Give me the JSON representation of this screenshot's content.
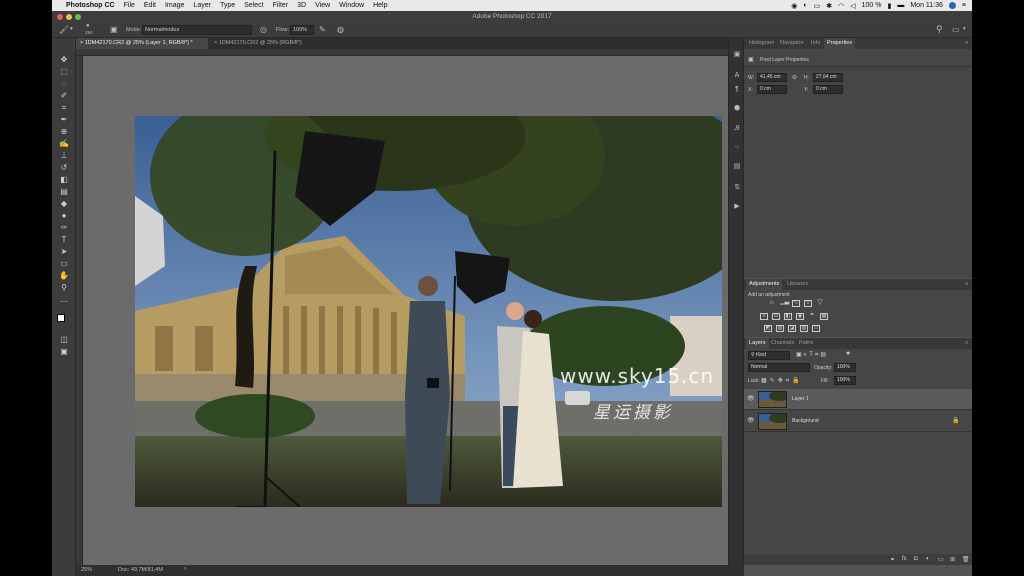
{
  "menubar": {
    "app_name": "Photoshop CC",
    "items": [
      "File",
      "Edit",
      "Image",
      "Layer",
      "Type",
      "Select",
      "Filter",
      "3D",
      "View",
      "Window",
      "Help"
    ],
    "battery": "100 %",
    "clock": "Mon 11:36"
  },
  "window": {
    "title": "Adobe Photoshop CC 2017"
  },
  "options": {
    "brush_size": "250",
    "mode_label": "Mode:",
    "mode_value": "Normalmodus",
    "flow_label": "Flow:",
    "flow_value": "100%"
  },
  "doc_tabs": [
    {
      "label": "1DM42170.CR2 @ 25% (Layer 1, RGB/8*) *"
    },
    {
      "label": "1DM42170.CR2 @ 25% (RGB/8*)"
    }
  ],
  "statusbar": {
    "zoom": "25%",
    "doc_info": "Doc: 49,7M/81,4M"
  },
  "properties": {
    "tabs": [
      "Histogram",
      "Navigator",
      "Info",
      "Properties"
    ],
    "heading": "Pixel Layer Properties",
    "w_label": "W:",
    "w_value": "41,45 cm",
    "h_label": "H:",
    "h_value": "27,64 cm",
    "x_label": "X:",
    "x_value": "0 cm",
    "y_label": "Y:",
    "y_value": "0 cm"
  },
  "adjustments": {
    "tabs": [
      "Adjustments",
      "Libraries"
    ],
    "hint": "Add an adjustment"
  },
  "layers": {
    "tabs": [
      "Layers",
      "Channels",
      "Paths"
    ],
    "kind_filter": "Kind",
    "blend_mode": "Normal",
    "opacity_label": "Opacity:",
    "opacity_value": "100%",
    "lock_label": "Lock:",
    "fill_label": "Fill:",
    "fill_value": "100%",
    "items": [
      {
        "name": "Layer 1",
        "selected": true
      },
      {
        "name": "Background",
        "selected": false
      }
    ]
  },
  "watermark": {
    "url": "www.sky15.cn",
    "text": "星运摄影"
  },
  "colors": {
    "ps_dark": "#3c3c3c",
    "ps_panel": "#464646",
    "selection": "#5a5a5a"
  }
}
